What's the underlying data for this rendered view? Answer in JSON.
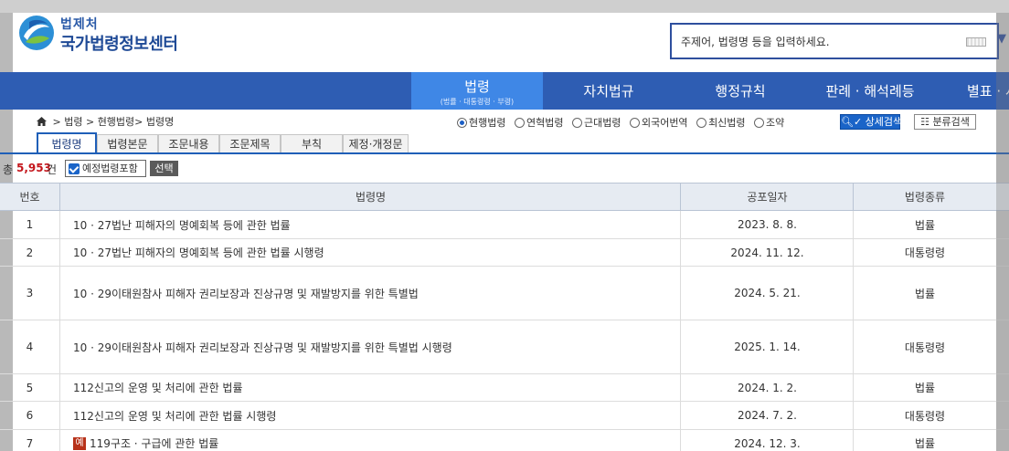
{
  "header": {
    "logo_small": "법제처",
    "logo_big": "국가법령정보센터",
    "search_placeholder": "주제어, 법령명 등을 입력하세요.",
    "icons": [
      "logo-emblem-icon",
      "keyboard-icon",
      "dropdown-arrow-icon"
    ]
  },
  "nav": {
    "items": [
      {
        "label": "법령",
        "sub": "(법률 · 대통령령 · 부령)",
        "active": true
      },
      {
        "label": "자치법규"
      },
      {
        "label": "행정규칙"
      },
      {
        "label": "판례 · 해석례등"
      },
      {
        "label": "별표 · 서"
      }
    ]
  },
  "breadcrumb": {
    "items": [
      "법령",
      "현행법령",
      "법령명"
    ],
    "sep": ">"
  },
  "filters": {
    "options": [
      {
        "label": "현행법령",
        "checked": true
      },
      {
        "label": "연혁법령",
        "checked": false
      },
      {
        "label": "근대법령",
        "checked": false
      },
      {
        "label": "외국어번역",
        "checked": false
      },
      {
        "label": "최신법령",
        "checked": false
      },
      {
        "label": "조약",
        "checked": false
      }
    ],
    "detail_search_label": "상세검색",
    "class_search_label": "분류검색"
  },
  "tabs": [
    {
      "label": "법령명",
      "active": true
    },
    {
      "label": "법령본문"
    },
    {
      "label": "조문내용"
    },
    {
      "label": "조문제목"
    },
    {
      "label": "부칙"
    },
    {
      "label": "제정·개정문"
    }
  ],
  "results": {
    "total_label": "총",
    "total_count": "5,953",
    "total_unit": "건",
    "include_pending_label": "예정법령포함",
    "include_pending_checked": true,
    "select_label": "선택"
  },
  "table": {
    "columns": [
      "번호",
      "법령명",
      "공포일자",
      "법령종류"
    ],
    "rows": [
      {
        "no": "1",
        "name": "10 · 27법난 피해자의 명예회복 등에 관한 법률",
        "date": "2023. 8. 8.",
        "type": "법률"
      },
      {
        "no": "2",
        "name": "10 · 27법난 피해자의 명예회복 등에 관한 법률 시행령",
        "date": "2024. 11. 12.",
        "type": "대통령령"
      },
      {
        "no": "3",
        "name": "10 · 29이태원참사 피해자 권리보장과 진상규명 및 재발방지를 위한 특별법",
        "date": "2024. 5. 21.",
        "type": "법률"
      },
      {
        "no": "4",
        "name": "10 · 29이태원참사 피해자 권리보장과 진상규명 및 재발방지를 위한 특별법 시행령",
        "date": "2025. 1. 14.",
        "type": "대통령령"
      },
      {
        "no": "5",
        "name": "112신고의 운영 및 처리에 관한 법률",
        "date": "2024. 1. 2.",
        "type": "법률"
      },
      {
        "no": "6",
        "name": "112신고의 운영 및 처리에 관한 법률 시행령",
        "date": "2024. 7. 2.",
        "type": "대통령령"
      },
      {
        "no": "7",
        "badge": "예",
        "name": "119구조 · 구급에 관한 법률",
        "date": "2024. 12. 3.",
        "type": "법률"
      }
    ]
  }
}
